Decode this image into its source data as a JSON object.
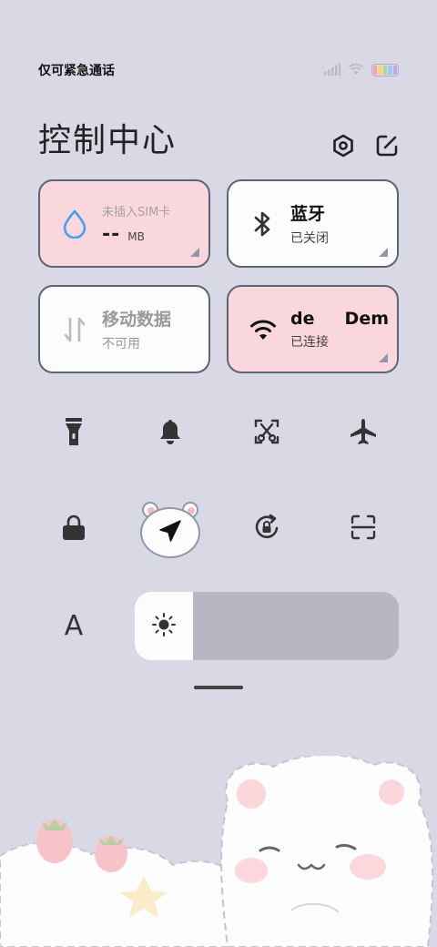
{
  "status": {
    "carrier_text": "仅可紧急通话",
    "signal_icon": "signal-bars-icon",
    "wifi_icon": "wifi-icon",
    "battery_colors": [
      "#f6a2a2",
      "#f7d47a",
      "#a6dd8c",
      "#9ccbf2",
      "#c9a3e9"
    ]
  },
  "header": {
    "title": "控制中心",
    "settings_icon": "settings-hexagon-icon",
    "edit_icon": "edit-icon"
  },
  "tiles": {
    "sim": {
      "top": "未插入SIM卡",
      "value": "--",
      "unit": "MB"
    },
    "bluetooth": {
      "title": "蓝牙",
      "status": "已关闭"
    },
    "mobile_data": {
      "title": "移动数据",
      "status": "不可用"
    },
    "wifi": {
      "title": "de     Dem",
      "status": "已连接"
    }
  },
  "toggles_row1": [
    "flashlight-icon",
    "bell-icon",
    "screenshot-scissors-icon",
    "airplane-icon"
  ],
  "toggles_row2": [
    "lock-icon",
    "location-icon",
    "rotation-lock-icon",
    "scan-icon"
  ],
  "font_toggle": "A",
  "brightness": {
    "level": 0.22
  },
  "colors": {
    "background": "#d9d9e5",
    "tile_pink": "#fad7dc",
    "tile_border": "#5b6577",
    "accent_blue": "#3fa4ec"
  }
}
